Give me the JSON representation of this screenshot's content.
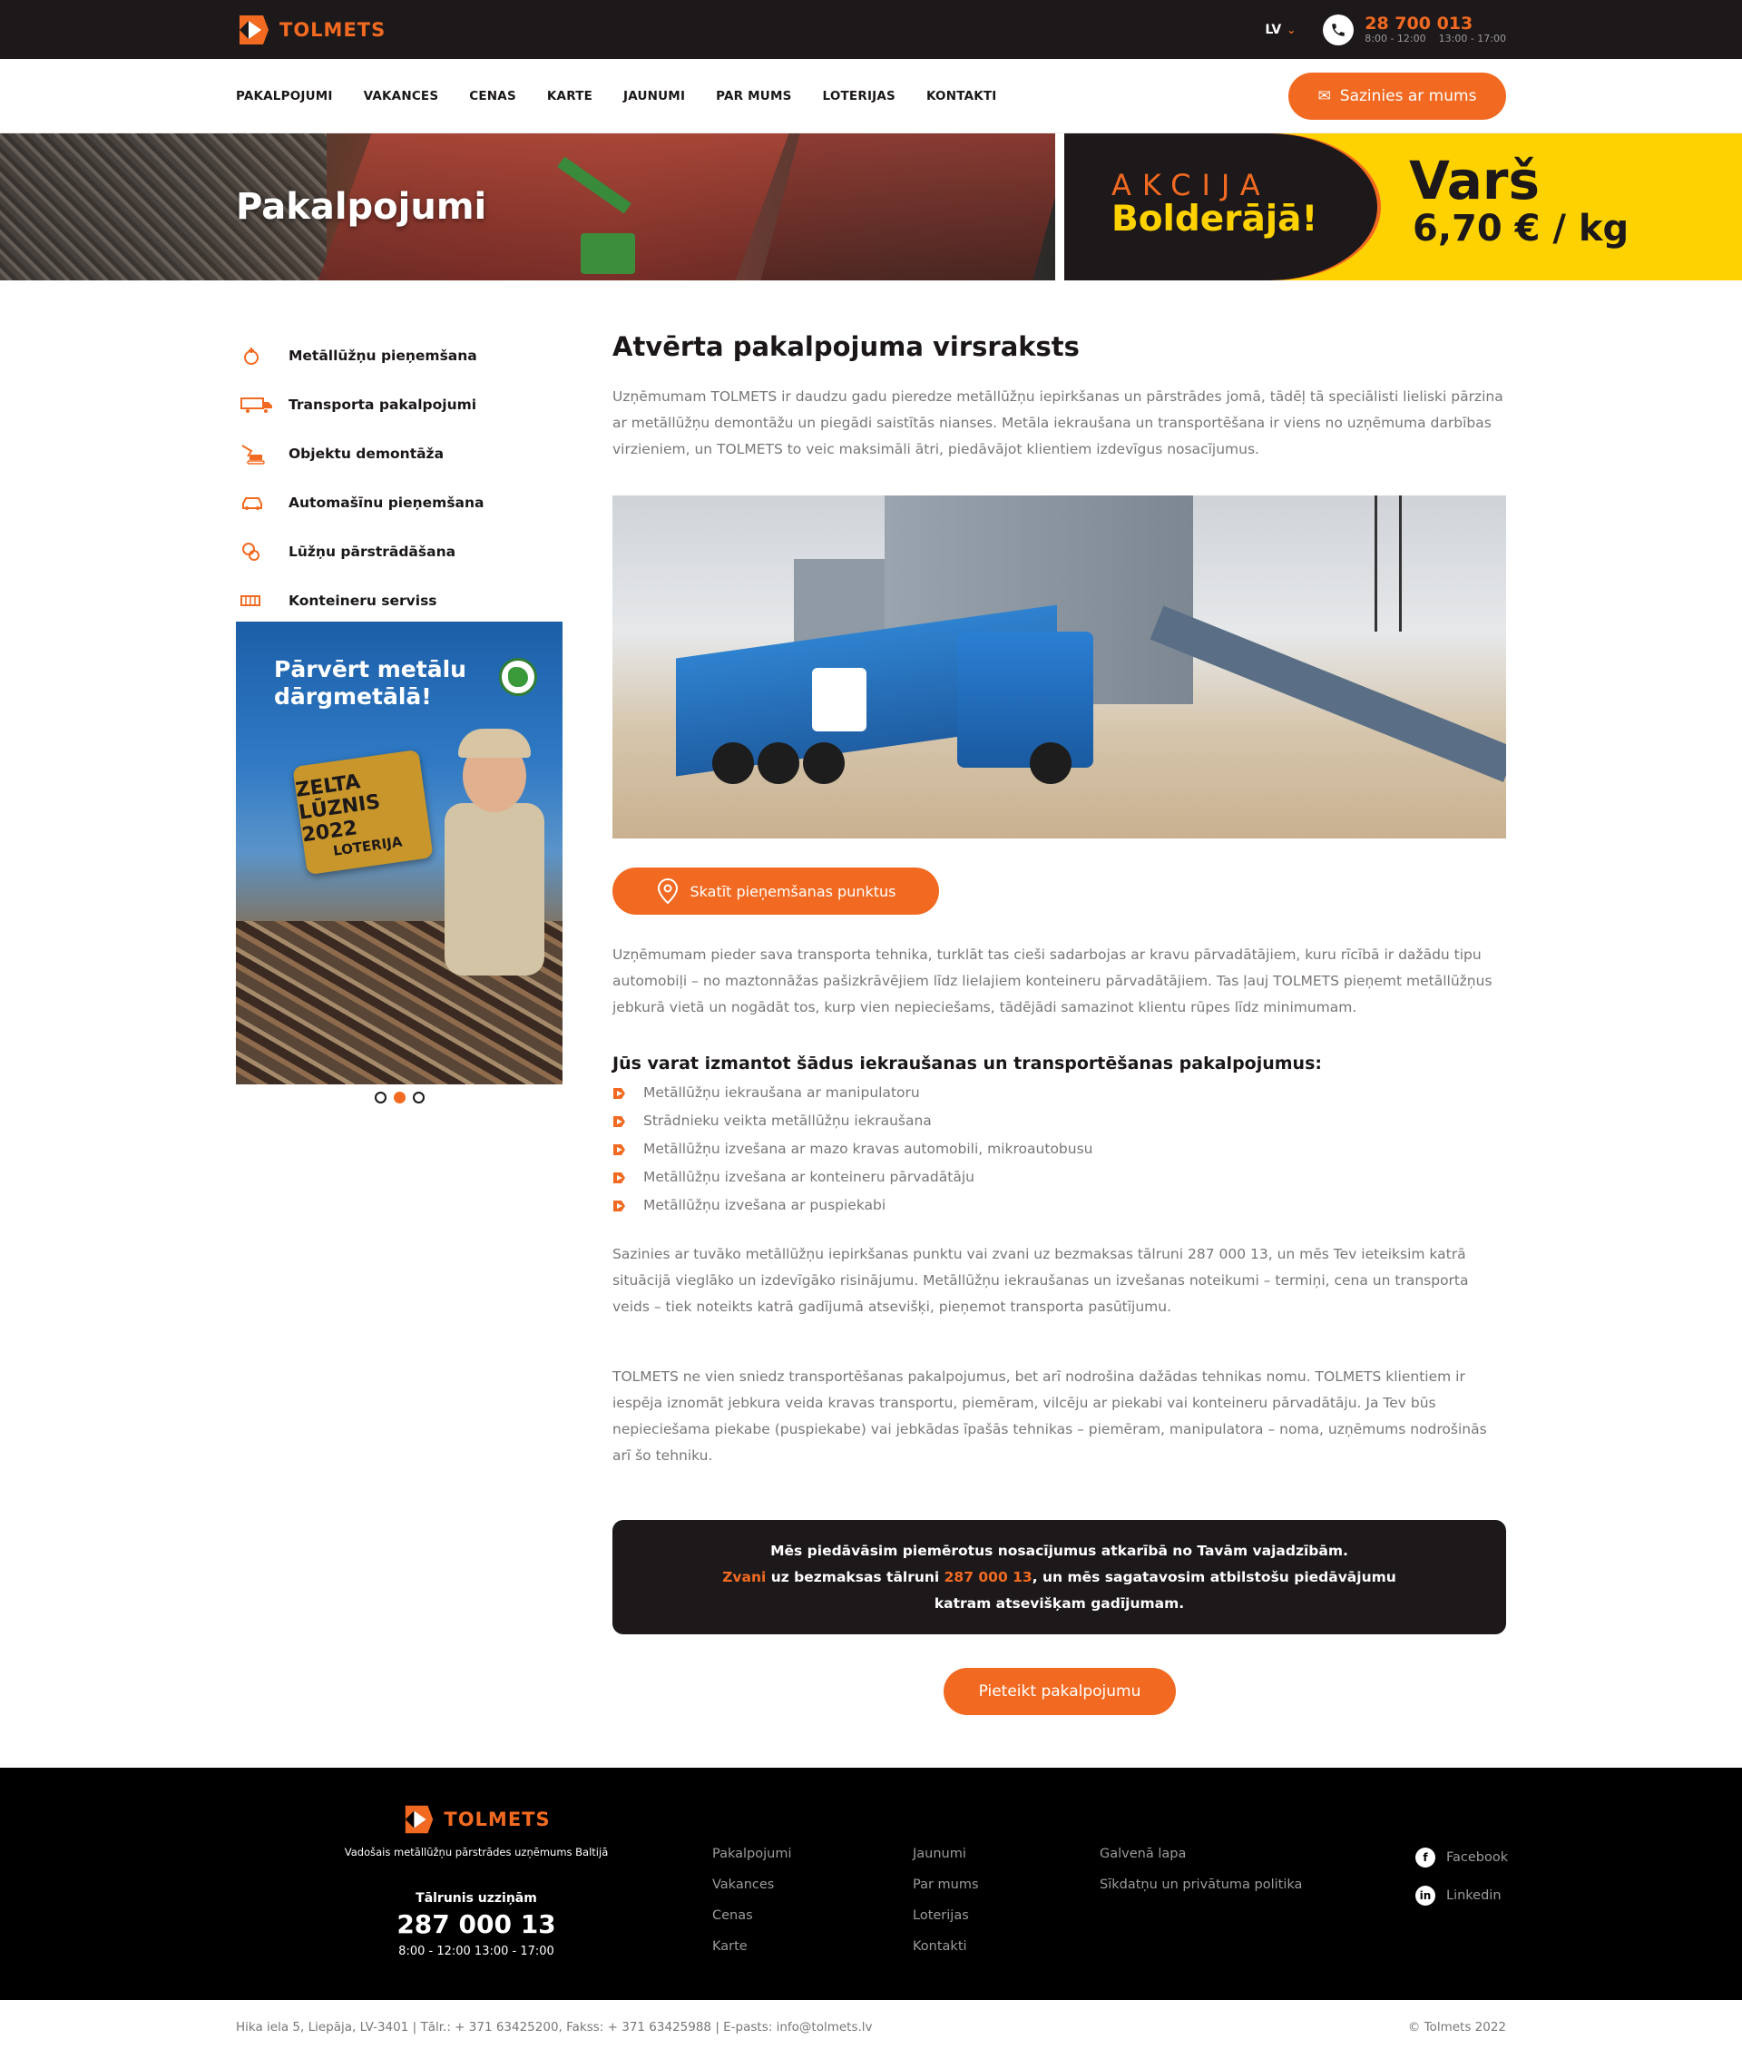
{
  "header": {
    "logo_text": "TOLMETS",
    "language": "LV",
    "phone": "28 700 013",
    "hours_1": "8:00 - 12:00",
    "hours_2": "13:00 - 17:00"
  },
  "nav": {
    "items": [
      "PAKALPOJUMI",
      "VAKANCES",
      "CENAS",
      "KARTE",
      "JAUNUMI",
      "PAR MUMS",
      "LOTERIJAS",
      "KONTAKTI"
    ],
    "contact_button": "Sazinies ar mums"
  },
  "banner": {
    "title": "Pakalpojumi",
    "promo_line1": "AKCIJA",
    "promo_line2": "Bolderājā!",
    "promo_metal": "Varš",
    "promo_price": "6,70 € / kg"
  },
  "sidebar": {
    "items": [
      {
        "label": "Metāllūžņu pieņemšana",
        "icon": "scrap-icon"
      },
      {
        "label": "Transporta pakalpojumi",
        "icon": "truck-icon"
      },
      {
        "label": "Objektu demontāža",
        "icon": "excavator-icon"
      },
      {
        "label": "Automašīnu pieņemšana",
        "icon": "car-icon"
      },
      {
        "label": "Lūžņu pārstrādāšana",
        "icon": "recycle-icon"
      },
      {
        "label": "Konteineru serviss",
        "icon": "container-icon"
      }
    ],
    "ad_title_1": "Pārvērt metālu",
    "ad_title_2": "dārgmetālā!",
    "ad_seal_title": "ZELTA LŪZNIS 2022",
    "ad_seal_sub": "LOTERIJA",
    "carousel_active": 2,
    "carousel_total": 3
  },
  "content": {
    "title": "Atvērta pakalpojuma virsraksts",
    "intro": "Uzņēmumam TOLMETS ir daudzu gadu pieredze metāllūžņu iepirkšanas un pārstrādes jomā, tādēļ tā speciālisti lieliski pārzina ar metāllūžņu demontāžu un piegādi saistītās nianses. Metāla iekraušana un transportēšana ir viens no uzņēmuma darbības virzieniem, un TOLMETS to veic maksimāli ātri, piedāvājot klientiem izdevīgus nosacījumus.",
    "points_button": "Skatīt pieņemšanas punktus",
    "para2": "Uzņēmumam pieder sava transporta tehnika, turklāt tas cieši sadarbojas ar kravu pārvadātājiem, kuru rīcībā ir dažādu tipu automobiļi – no maztonnāžas pašizkrāvējiem līdz lielajiem konteineru pārvadātājiem. Tas ļauj TOLMETS pieņemt metāllūžņus jebkurā vietā un nogādāt tos, kurp vien nepieciešams, tādējādi samazinot klientu rūpes līdz minimumam.",
    "list_title": "Jūs varat izmantot šādus iekraušanas un transportēšanas pakalpojumus:",
    "list": [
      "Metāllūžņu iekraušana ar manipulatoru",
      "Strādnieku veikta metāllūžņu iekraušana",
      "Metāllūžņu izvešana ar mazo kravas automobili, mikroautobusu",
      "Metāllūžņu izvešana ar konteineru pārvadātāju",
      "Metāllūžņu izvešana ar puspiekabi"
    ],
    "para3": "Sazinies ar tuvāko metāllūžņu iepirkšanas punktu vai zvani uz bezmaksas tālruni 287 000 13, un mēs Tev ieteiksim katrā situācijā vieglāko un izdevīgāko risinājumu. Metāllūžņu iekraušanas un izvešanas noteikumi – termiņi, cena un transporta veids – tiek noteikts katrā gadījumā atsevišķi, pieņemot transporta pasūtījumu.",
    "para4": "TOLMETS ne vien sniedz transportēšanas pakalpojumus, bet arī nodrošina dažādas tehnikas nomu. TOLMETS klientiem ir iespēja iznomāt jebkura veida kravas transportu, piemēram, vilcēju ar piekabi vai konteineru pārvadātāju. Ja Tev būs nepieciešama piekabe (puspiekabe) vai jebkādas īpašās tehnikas – piemēram, manipulatora – noma, uzņēmums nodrošinās arī šo tehniku.",
    "cta_line1": "Mēs piedāvāsim piemērotus nosacījumus atkarībā no Tavām vajadzībām.",
    "cta_call": "Zvani",
    "cta_mid": " uz bezmaksas tālruni ",
    "cta_phone": "287 000 13",
    "cta_end": ", un mēs sagatavosim atbilstošu piedāvājumu",
    "cta_line3": "katram atsevišķam gadījumam.",
    "order_button": "Pieteikt pakalpojumu"
  },
  "footer": {
    "logo_text": "TOLMETS",
    "tagline": "Vadošais metāllūžņu pārstrādes uzņēmums Baltijā",
    "call_label": "Tālrunis uzziņām",
    "phone": "287 000 13",
    "hours": "8:00 - 12:00 13:00 - 17:00",
    "col1": [
      "Pakalpojumi",
      "Vakances",
      "Cenas",
      "Karte"
    ],
    "col2": [
      "Jaunumi",
      "Par mums",
      "Loterijas",
      "Kontakti"
    ],
    "col3": [
      "Galvenā lapa",
      "Sīkdatņu un privātuma politika"
    ],
    "social": [
      "Facebook",
      "Linkedin"
    ],
    "address": "Hika iela 5, Liepāja, LV-3401 | Tālr.: + 371 63425200, Fakss: + 371 63425988 | E-pasts: info@tolmets.lv",
    "copyright": "© Tolmets 2022"
  },
  "colors": {
    "accent": "#f26a21",
    "dark": "#1d191a",
    "promo_yellow": "#fed200",
    "text_muted": "#7a7677"
  }
}
